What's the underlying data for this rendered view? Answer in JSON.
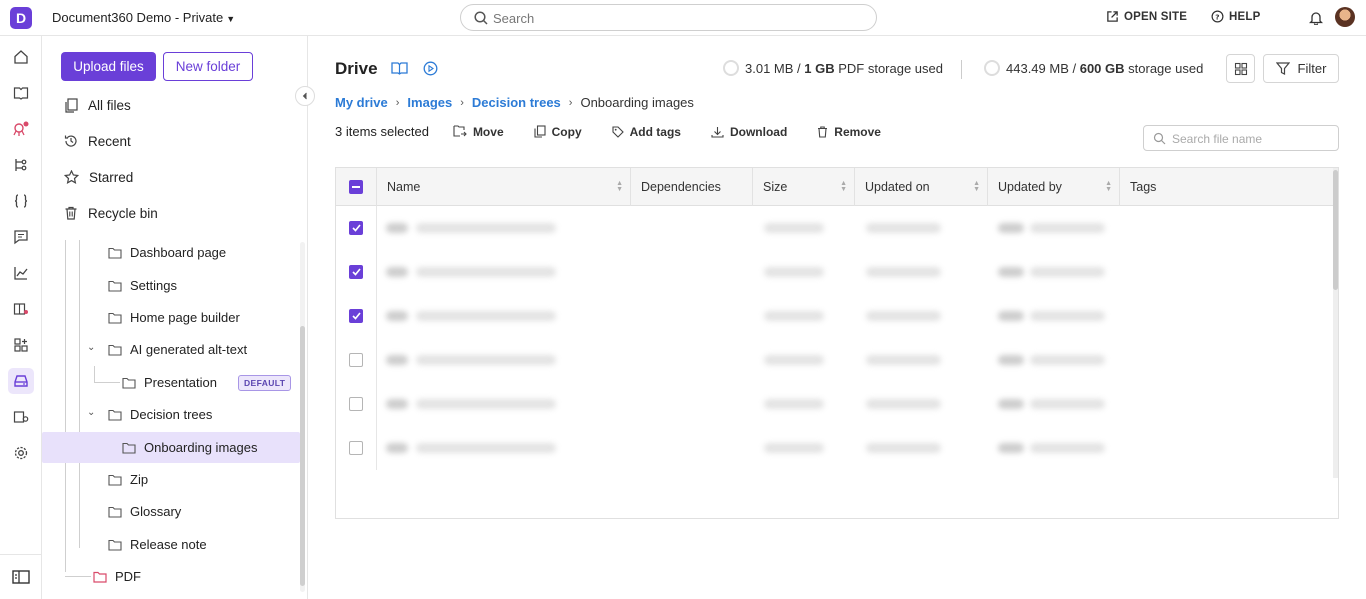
{
  "topbar": {
    "logo_letter": "D",
    "project_name": "Document360 Demo - Private",
    "search_placeholder": "Search",
    "open_site": "OPEN SITE",
    "help": "HELP"
  },
  "sidebar": {
    "upload_label": "Upload files",
    "new_folder_label": "New folder",
    "nav": [
      {
        "label": "All files",
        "icon": "files-icon"
      },
      {
        "label": "Recent",
        "icon": "history-icon"
      },
      {
        "label": "Starred",
        "icon": "star-icon"
      },
      {
        "label": "Recycle bin",
        "icon": "trash-icon"
      }
    ],
    "tree": [
      {
        "label": "Dashboard page"
      },
      {
        "label": "Settings"
      },
      {
        "label": "Home page builder"
      },
      {
        "label": "AI generated alt-text"
      },
      {
        "label": "Presentation",
        "badge": "DEFAULT"
      },
      {
        "label": "Decision trees"
      },
      {
        "label": "Onboarding images"
      },
      {
        "label": "Zip"
      },
      {
        "label": "Glossary"
      },
      {
        "label": "Release note"
      },
      {
        "label": "PDF"
      }
    ]
  },
  "main": {
    "title": "Drive",
    "pdf_storage": {
      "used": "3.01 MB",
      "slash": " / ",
      "total": "1 GB",
      "suffix": " PDF storage used"
    },
    "storage": {
      "used": "443.49 MB",
      "slash": " / ",
      "total": "600 GB",
      "suffix": " storage used"
    },
    "filter_label": "Filter",
    "breadcrumb": [
      "My drive",
      "Images",
      "Decision trees",
      "Onboarding images"
    ],
    "selected_count": "3 items selected",
    "actions": [
      "Move",
      "Copy",
      "Add tags",
      "Download",
      "Remove"
    ],
    "file_search_placeholder": "Search file name",
    "columns": [
      "Name",
      "Dependencies",
      "Size",
      "Updated on",
      "Updated by",
      "Tags"
    ],
    "rows_checked": [
      true,
      true,
      true,
      false,
      false,
      false
    ]
  },
  "colors": {
    "accent": "#6a3fd8",
    "link": "#2c7bd6",
    "selected_bg": "#e8e1fb"
  }
}
